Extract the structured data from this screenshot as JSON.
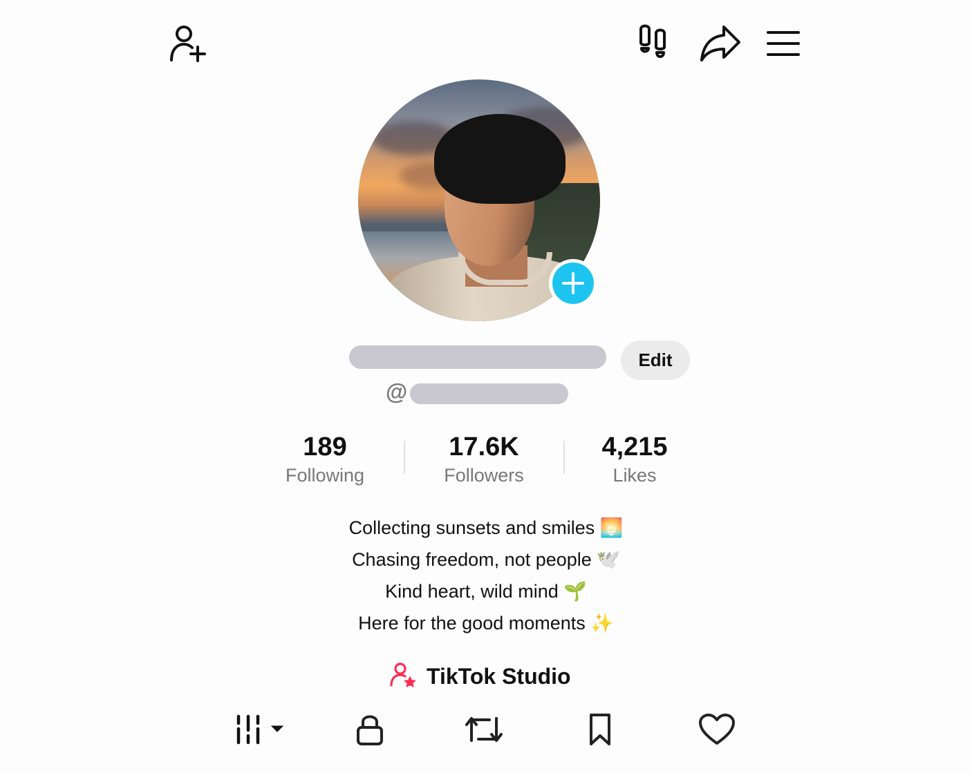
{
  "header": {
    "icons": [
      "add-friend-icon",
      "footprints-icon",
      "share-icon",
      "menu-icon"
    ]
  },
  "profile": {
    "avatar_icon": "add-plus-icon",
    "edit_label": "Edit",
    "handle_prefix": "@",
    "colors": {
      "accent": "#1ec4f0",
      "studio_icon": "#fe2c55",
      "muted": "#777777",
      "redaction": "#c9c8d0"
    }
  },
  "stats": [
    {
      "value": "189",
      "label": "Following"
    },
    {
      "value": "17.6K",
      "label": "Followers"
    },
    {
      "value": "4,215",
      "label": "Likes"
    }
  ],
  "bio": [
    "Collecting sunsets and smiles 🌅",
    "Chasing freedom, not people 🕊️",
    "Kind heart, wild mind 🌱",
    "Here for the good moments ✨"
  ],
  "studio": {
    "label": "TikTok Studio",
    "icon": "creator-star-icon"
  },
  "tabs": [
    {
      "icon": "videos-grid-icon",
      "selected": true
    },
    {
      "icon": "lock-icon"
    },
    {
      "icon": "repost-icon"
    },
    {
      "icon": "bookmark-icon"
    },
    {
      "icon": "heart-icon"
    }
  ]
}
